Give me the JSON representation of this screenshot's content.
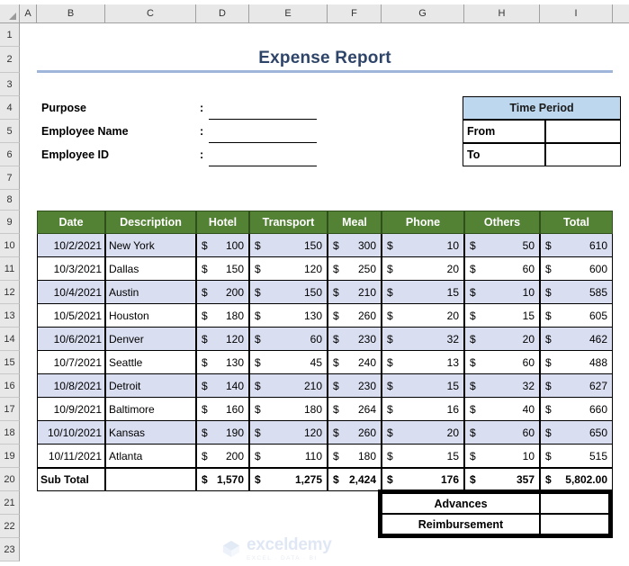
{
  "spreadsheet": {
    "column_headers": [
      "A",
      "B",
      "C",
      "D",
      "E",
      "F",
      "G",
      "H",
      "I"
    ],
    "row_headers": [
      "1",
      "2",
      "3",
      "4",
      "5",
      "6",
      "7",
      "8",
      "9",
      "10",
      "11",
      "12",
      "13",
      "14",
      "15",
      "16",
      "17",
      "18",
      "19",
      "20",
      "21",
      "22",
      "23"
    ]
  },
  "title": "Expense Report",
  "form": {
    "fields": [
      {
        "label": "Purpose",
        "separator": ":",
        "value": ""
      },
      {
        "label": "Employee Name",
        "separator": ":",
        "value": ""
      },
      {
        "label": "Employee ID",
        "separator": ":",
        "value": ""
      }
    ]
  },
  "time_period": {
    "header": "Time Period",
    "rows": [
      {
        "label": "From",
        "value": ""
      },
      {
        "label": "To",
        "value": ""
      }
    ]
  },
  "table": {
    "columns": [
      "Date",
      "Description",
      "Hotel",
      "Transport",
      "Meal",
      "Phone",
      "Others",
      "Total"
    ],
    "currency_symbol": "$",
    "rows": [
      {
        "date": "10/2/2021",
        "description": "New York",
        "hotel": "100",
        "transport": "150",
        "meal": "300",
        "phone": "10",
        "others": "50",
        "total": "610"
      },
      {
        "date": "10/3/2021",
        "description": "Dallas",
        "hotel": "150",
        "transport": "120",
        "meal": "250",
        "phone": "20",
        "others": "60",
        "total": "600"
      },
      {
        "date": "10/4/2021",
        "description": "Austin",
        "hotel": "200",
        "transport": "150",
        "meal": "210",
        "phone": "15",
        "others": "10",
        "total": "585"
      },
      {
        "date": "10/5/2021",
        "description": "Houston",
        "hotel": "180",
        "transport": "130",
        "meal": "260",
        "phone": "20",
        "others": "15",
        "total": "605"
      },
      {
        "date": "10/6/2021",
        "description": "Denver",
        "hotel": "120",
        "transport": "60",
        "meal": "230",
        "phone": "32",
        "others": "20",
        "total": "462"
      },
      {
        "date": "10/7/2021",
        "description": "Seattle",
        "hotel": "130",
        "transport": "45",
        "meal": "240",
        "phone": "13",
        "others": "60",
        "total": "488"
      },
      {
        "date": "10/8/2021",
        "description": "Detroit",
        "hotel": "140",
        "transport": "210",
        "meal": "230",
        "phone": "15",
        "others": "32",
        "total": "627"
      },
      {
        "date": "10/9/2021",
        "description": "Baltimore",
        "hotel": "160",
        "transport": "180",
        "meal": "264",
        "phone": "16",
        "others": "40",
        "total": "660"
      },
      {
        "date": "10/10/2021",
        "description": "Kansas",
        "hotel": "190",
        "transport": "120",
        "meal": "260",
        "phone": "20",
        "others": "60",
        "total": "650"
      },
      {
        "date": "10/11/2021",
        "description": "Atlanta",
        "hotel": "200",
        "transport": "110",
        "meal": "180",
        "phone": "15",
        "others": "10",
        "total": "515"
      }
    ],
    "subtotal": {
      "label": "Sub Total",
      "description": "",
      "hotel": "1,570",
      "transport": "1,275",
      "meal": "2,424",
      "phone": "176",
      "others": "357",
      "total": "5,802.00"
    }
  },
  "summary": {
    "rows": [
      {
        "label": "Advances",
        "value": ""
      },
      {
        "label": "Reimbursement",
        "value": ""
      }
    ]
  },
  "watermark": {
    "brand": "exceldemy",
    "tagline": "EXCEL · DATA · BI"
  },
  "colors": {
    "header_green": "#548235",
    "band_blue": "#d9def0",
    "title_navy": "#2e4468",
    "title_rule": "#9fb6da",
    "timeperiod_blue": "#bdd7ee"
  }
}
